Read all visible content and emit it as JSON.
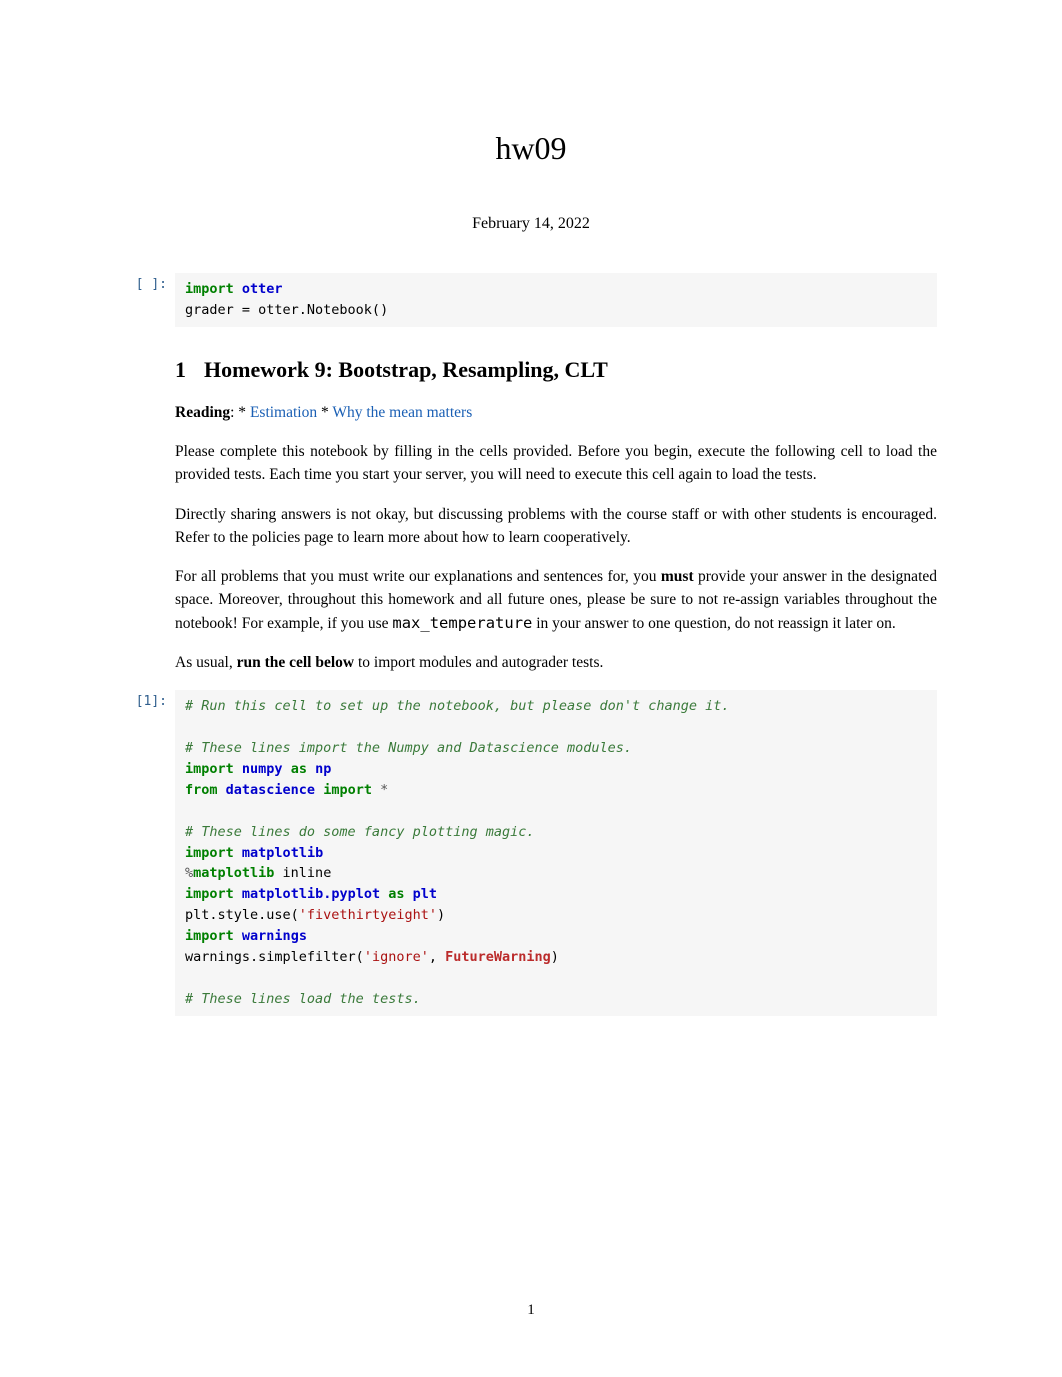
{
  "title": "hw09",
  "date": "February 14, 2022",
  "cell1": {
    "prompt": "[ ]:",
    "lines": {
      "l1_kw": "import",
      "l1_mod": "otter",
      "l2": "grader = otter.Notebook()"
    }
  },
  "section": {
    "num": "1",
    "title": "Homework 9: Bootstrap, Resampling, CLT"
  },
  "reading": {
    "label": "Reading",
    "sep1": ": * ",
    "link1": "Estimation",
    "sep2": " * ",
    "link2": "Why the mean matters"
  },
  "para1": "Please complete this notebook by filling in the cells provided. Before you begin, execute the following cell to load the provided tests. Each time you start your server, you will need to execute this cell again to load the tests.",
  "para2": "Directly sharing answers is not okay, but discussing problems with the course staff or with other students is encouraged. Refer to the policies page to learn more about how to learn cooperatively.",
  "para3": {
    "a": "For all problems that you must write our explanations and sentences for, you ",
    "b": "must",
    "c": " provide your answer in the designated space. Moreover, throughout this homework and all future ones, please be sure to not re-assign variables throughout the notebook! For example, if you use ",
    "d": "max_temperature",
    "e": " in your answer to one question, do not reassign it later on."
  },
  "para4": {
    "a": "As usual, ",
    "b": "run the cell below",
    "c": " to import modules and autograder tests."
  },
  "cell2": {
    "prompt": "[1]:",
    "c1": "# Run this cell to set up the notebook, but please don't change it.",
    "c2": "# These lines import the Numpy and Datascience modules.",
    "l1a": "import",
    "l1b": "numpy",
    "l1c": "as",
    "l1d": "np",
    "l2a": "from",
    "l2b": "datascience",
    "l2c": "import",
    "l2d": "*",
    "c3": "# These lines do some fancy plotting magic.",
    "l3a": "import",
    "l3b": "matplotlib",
    "l4a": "%",
    "l4b": "matplotlib",
    "l4c": " inline",
    "l5a": "import",
    "l5b": "matplotlib.pyplot",
    "l5c": "as",
    "l5d": "plt",
    "l6a": "plt.style.use(",
    "l6b": "'fivethirtyeight'",
    "l6c": ")",
    "l7a": "import",
    "l7b": "warnings",
    "l8a": "warnings.simplefilter(",
    "l8b": "'ignore'",
    "l8c": ", ",
    "l8d": "FutureWarning",
    "l8e": ")",
    "c4": "# These lines load the tests."
  },
  "page_num": "1"
}
